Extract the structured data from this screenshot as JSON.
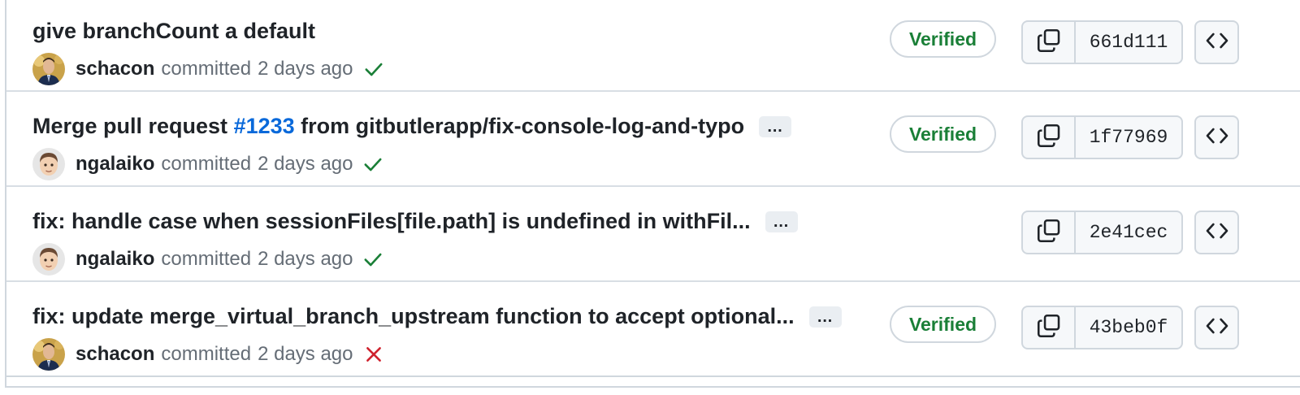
{
  "labels": {
    "committed": "committed",
    "verified": "Verified",
    "ellipsis": "…"
  },
  "colors": {
    "verified_green": "#1a7f37",
    "check_green": "#1a7f37",
    "fail_red": "#cf222e",
    "link_blue": "#0969da"
  },
  "commits": [
    {
      "message": "give branchCount a default",
      "author": "schacon",
      "time": "2 days ago",
      "status": "success",
      "verified": true,
      "sha": "661d111",
      "avatar": "schacon-avatar"
    },
    {
      "message_prefix": "Merge pull request ",
      "pr_link": "#1233",
      "message_suffix": " from gitbutlerapp/fix-console-log-and-typo",
      "author": "ngalaiko",
      "time": "2 days ago",
      "status": "success",
      "verified": true,
      "sha": "1f77969",
      "avatar": "ngalaiko-avatar"
    },
    {
      "message": "fix: handle case when sessionFiles[file.path] is undefined in withFil...",
      "author": "ngalaiko",
      "time": "2 days ago",
      "status": "success",
      "verified": false,
      "sha": "2e41cec",
      "avatar": "ngalaiko-avatar"
    },
    {
      "message": "fix: update merge_virtual_branch_upstream function to accept optional...",
      "author": "schacon",
      "time": "2 days ago",
      "status": "failure",
      "verified": true,
      "sha": "43beb0f",
      "avatar": "schacon-avatar"
    }
  ]
}
